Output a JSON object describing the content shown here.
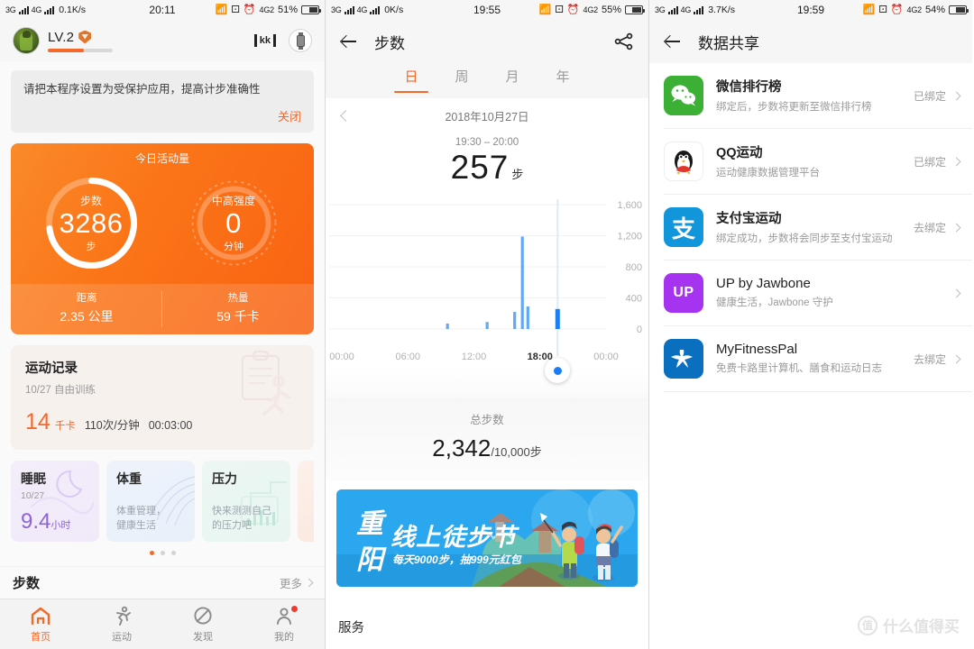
{
  "panel1": {
    "status": {
      "net1": "3G",
      "net2": "4G",
      "speed": "0.1K/s",
      "time": "20:11",
      "net_badge": "4G2",
      "battery": "51%"
    },
    "header": {
      "level": "LV.2",
      "kk_icon": "kk",
      "watch_icon": "watch-icon"
    },
    "notice": {
      "text": "请把本程序设置为受保护应用，提高计步准确性",
      "close": "关闭"
    },
    "activity": {
      "title": "今日活动量",
      "ring1": {
        "label": "步数",
        "value": "3286",
        "unit": "步",
        "progress": 0.72
      },
      "ring2": {
        "label": "中高强度",
        "value": "0",
        "unit": "分钟",
        "progress": 0
      },
      "footer": [
        {
          "label": "距离",
          "value": "2.35 公里"
        },
        {
          "label": "热量",
          "value": "59 千卡"
        }
      ]
    },
    "record": {
      "title": "运动记录",
      "subtitle": "10/27  自由训练",
      "kcal": "14",
      "kcal_unit": "千卡",
      "rate": "110次/分钟",
      "duration": "00:03:00"
    },
    "mini_cards": [
      {
        "title": "睡眠",
        "sub": "10/27",
        "value": "9.4",
        "value_unit": "小时",
        "desc": ""
      },
      {
        "title": "体重",
        "sub": "",
        "value": "",
        "value_unit": "",
        "desc": "体重管理，\n健康生活"
      },
      {
        "title": "压力",
        "sub": "",
        "value": "",
        "value_unit": "",
        "desc": "快来测测自己\n的压力吧"
      }
    ],
    "steps_row": {
      "title": "步数",
      "more": "更多"
    },
    "tabs": [
      {
        "label": "首页",
        "icon": "home-icon",
        "active": true
      },
      {
        "label": "运动",
        "icon": "running-icon",
        "active": false
      },
      {
        "label": "发现",
        "icon": "compass-icon",
        "active": false
      },
      {
        "label": "我的",
        "icon": "person-icon",
        "active": false
      }
    ]
  },
  "panel2": {
    "status": {
      "net1": "3G",
      "net2": "4G",
      "speed": "0K/s",
      "time": "19:55",
      "net_badge": "4G2",
      "battery": "55%"
    },
    "nav": {
      "title": "步数",
      "back_icon": "back-arrow-icon",
      "share_icon": "share-icon"
    },
    "tabs": [
      {
        "label": "日",
        "active": true
      },
      {
        "label": "周",
        "active": false
      },
      {
        "label": "月",
        "active": false
      },
      {
        "label": "年",
        "active": false
      }
    ],
    "date": "2018年10月27日",
    "selected_range": "19:30 – 20:00",
    "selected_steps": "257",
    "selected_unit": "步",
    "total_label": "总步数",
    "total_value": "2,342",
    "total_goal": "/10,000步",
    "banner": {
      "title_vertical": "重阳",
      "headline": "线上徒步节",
      "subline": "每天9000步，抽999元红包"
    },
    "service_label": "服务",
    "chart_data": {
      "type": "bar",
      "title": "步数",
      "xlabel": "",
      "ylabel": "",
      "ylim": [
        0,
        1600
      ],
      "yticks": [
        0,
        400,
        800,
        1200,
        1600
      ],
      "ytick_labels": [
        "0",
        "400",
        "800",
        "1,200",
        "1,600"
      ],
      "xticks": [
        "00:00",
        "06:00",
        "12:00",
        "18:00",
        "00:00"
      ],
      "xtick_hours": [
        0,
        6,
        12,
        18,
        24
      ],
      "grid": true,
      "legend": false,
      "bar_color": "#63a8f7",
      "highlight_color": "#1a7ef4",
      "marker_hour": 19.6,
      "x": [
        9.6,
        13.2,
        15.7,
        16.4,
        16.9,
        19.6
      ],
      "values": [
        70,
        90,
        220,
        1190,
        290,
        257
      ],
      "highlight_index": 5
    }
  },
  "panel3": {
    "status": {
      "net1": "3G",
      "net2": "4G",
      "speed": "3.7K/s",
      "time": "19:59",
      "net_badge": "4G2",
      "battery": "54%"
    },
    "nav": {
      "title": "数据共享",
      "back_icon": "back-arrow-icon"
    },
    "items": [
      {
        "name": "微信排行榜",
        "sub": "绑定后，步数将更新至微信排行榜",
        "status": "已绑定",
        "icon": "wechat-icon",
        "icon_bg": "#3cb034",
        "latin": false
      },
      {
        "name": "QQ运动",
        "sub": "运动健康数据管理平台",
        "status": "已绑定",
        "icon": "qq-penguin-icon",
        "icon_bg": "#ffffff",
        "latin": false
      },
      {
        "name": "支付宝运动",
        "sub": "绑定成功，步数将会同步至支付宝运动",
        "status": "去绑定",
        "icon": "alipay-icon",
        "icon_bg": "#1296db",
        "latin": false
      },
      {
        "name": "UP by Jawbone",
        "sub": "健康生活，Jawbone 守护",
        "status": "",
        "icon": "up-jawbone-icon",
        "icon_bg": "#a633f0",
        "latin": true
      },
      {
        "name": "MyFitnessPal",
        "sub": "免费卡路里计算机、膳食和运动日志",
        "status": "去绑定",
        "icon": "myfitnesspal-icon",
        "icon_bg": "#0b6fc0",
        "latin": true
      }
    ],
    "watermark": {
      "mark": "值",
      "text": "什么值得买"
    }
  }
}
